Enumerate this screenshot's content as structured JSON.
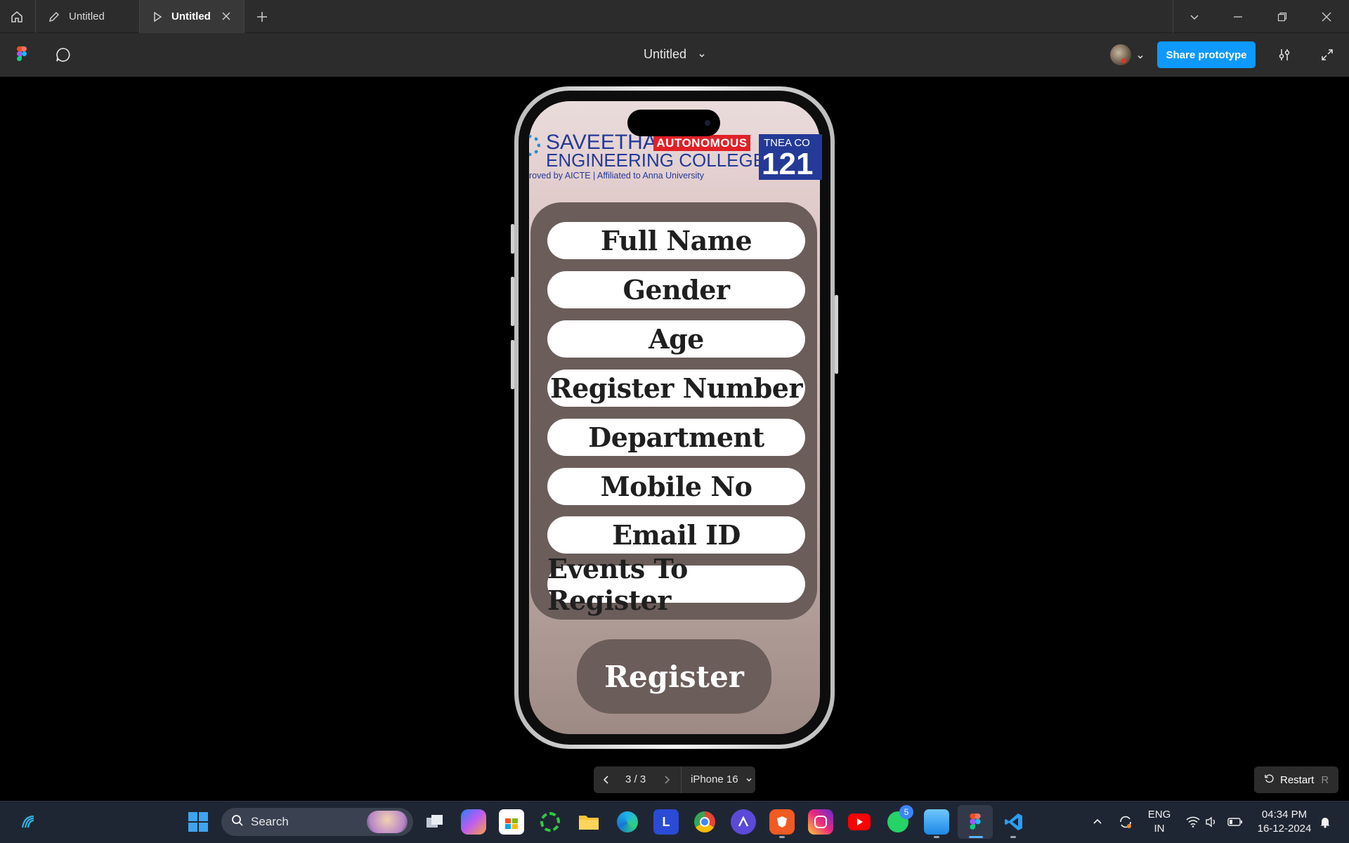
{
  "tabs": [
    {
      "label": "Untitled",
      "active": false
    },
    {
      "label": "Untitled",
      "active": true
    }
  ],
  "toolbar": {
    "document_title": "Untitled",
    "share_label": "Share prototype"
  },
  "logo": {
    "college_line1": "SAVEETHA",
    "badge": "AUTONOMOUS",
    "college_line2": "ENGINEERING COLLEGE",
    "tagline": "roved by AICTE  |  Affiliated to Anna University",
    "tnea_label": "TNEA CO",
    "tnea_code": "121"
  },
  "form": {
    "fields": [
      {
        "label": "Full Name"
      },
      {
        "label": "Gender"
      },
      {
        "label": "Age"
      },
      {
        "label": "Register Number"
      },
      {
        "label": "Department"
      },
      {
        "label": "Mobile No"
      },
      {
        "label": "Email ID"
      },
      {
        "label": "Events To Register"
      }
    ],
    "register_label": "Register"
  },
  "pager": {
    "page": "3 / 3",
    "device": "iPhone 16"
  },
  "restart": {
    "label": "Restart",
    "shortcut": "R"
  },
  "taskbar": {
    "search_placeholder": "Search",
    "whatsapp_badge": "5",
    "lang_top": "ENG",
    "lang_bottom": "IN",
    "time": "04:34 PM",
    "date": "16-12-2024"
  },
  "colors": {
    "accent": "#0d99ff",
    "panel": "#6b5d5a",
    "logo_blue": "#243a97",
    "logo_red": "#e12127"
  }
}
